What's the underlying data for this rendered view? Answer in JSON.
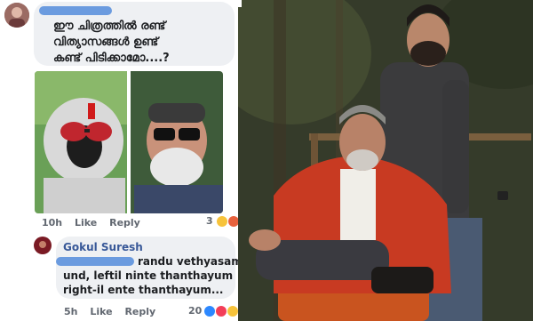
{
  "comment1": {
    "text_line1": "ഈ ചിത്രത്തിൽ രണ്ട്",
    "text_line2": "വിത്യാസങ്ങൾ ഉണ്ട്",
    "text_line3": "കണ്ട് പിടിക്കാമോ....?",
    "time": "10h",
    "like": "Like",
    "reply": "Reply",
    "reaction_count": "3"
  },
  "comment2": {
    "author": "Gokul Suresh",
    "text_line1": "randu vethyasam",
    "text_line2": "und, leftil ninte thanthayum",
    "text_line3": "right-il ente thanthayum...",
    "time": "5h",
    "like": "Like",
    "reply": "Reply",
    "reaction_count": "20"
  },
  "colors": {
    "link": "#385898",
    "bubble": "#eef0f3",
    "jacket": "#c83a22"
  }
}
